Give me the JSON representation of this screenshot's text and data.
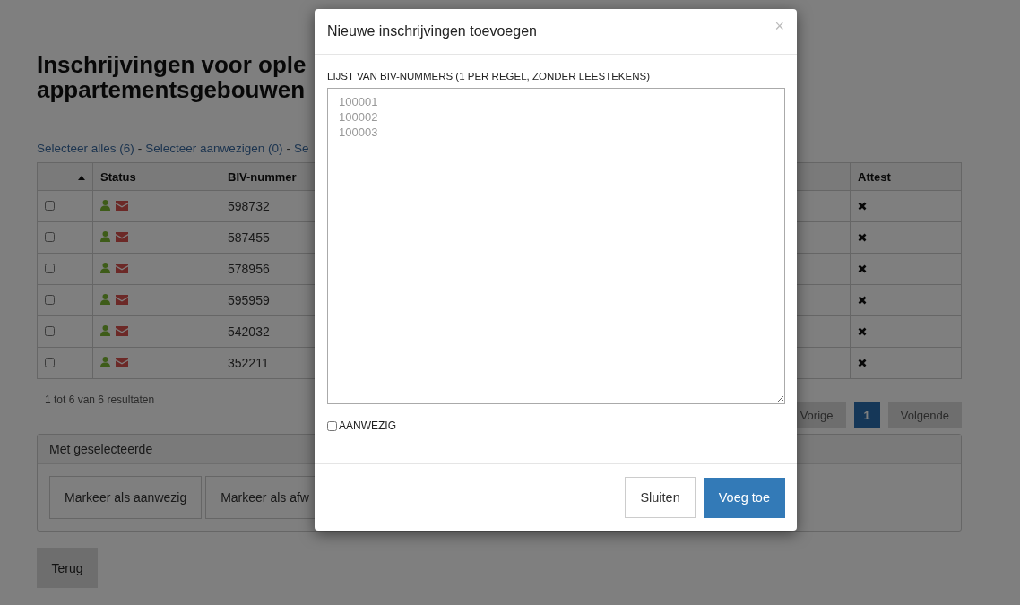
{
  "page": {
    "title_lines": [
      "Inschrijvingen voor ople",
      "appartementsgebouwen"
    ],
    "select_links": [
      {
        "label": "Selecteer alles (6)"
      },
      {
        "label": "Selecteer aanwezigen (0)"
      },
      {
        "label": "Se"
      }
    ],
    "separator": "-",
    "table": {
      "columns": [
        "Status",
        "BIV-nummer",
        "Attest"
      ],
      "rows": [
        {
          "checked": false,
          "icons": [
            {
              "kind": "user"
            },
            {
              "kind": "envelope"
            }
          ],
          "biv": "598732",
          "attest": false
        },
        {
          "checked": false,
          "icons": [
            {
              "kind": "user"
            },
            {
              "kind": "envelope"
            }
          ],
          "biv": "587455",
          "attest": false
        },
        {
          "checked": false,
          "icons": [
            {
              "kind": "user"
            },
            {
              "kind": "envelope"
            }
          ],
          "biv": "578956",
          "attest": false
        },
        {
          "checked": false,
          "icons": [
            {
              "kind": "user"
            },
            {
              "kind": "envelope"
            }
          ],
          "biv": "595959",
          "attest": false
        },
        {
          "checked": false,
          "icons": [
            {
              "kind": "user"
            },
            {
              "kind": "envelope"
            }
          ],
          "biv": "542032",
          "attest": false
        },
        {
          "checked": false,
          "icons": [
            {
              "kind": "user"
            },
            {
              "kind": "envelope"
            }
          ],
          "biv": "352211",
          "attest": false
        }
      ]
    },
    "results": "1 tot 6 van 6 resultaten",
    "pagination": {
      "previous": "Vorige",
      "pages": [
        {
          "label": "1",
          "selected": true
        }
      ],
      "next": "Volgende"
    },
    "bulk_panel": {
      "title": "Met geselecteerde",
      "buttons": [
        "Markeer als aanwezig",
        "Markeer als afw"
      ]
    },
    "back_button": "Terug"
  },
  "modal": {
    "title": "Nieuwe inschrijvingen toevoegen",
    "close": "×",
    "field_label": "LIJST VAN BIV-NUMMERS (1 PER REGEL, ZONDER LEESTEKENS)",
    "placeholder": "100001\n100002\n100003",
    "present_checkbox": {
      "label": "AANWEZIG",
      "checked": false
    },
    "buttons": [
      {
        "label": "Sluiten",
        "kind": "default"
      },
      {
        "label": "Voeg toe",
        "kind": "primary"
      }
    ]
  }
}
